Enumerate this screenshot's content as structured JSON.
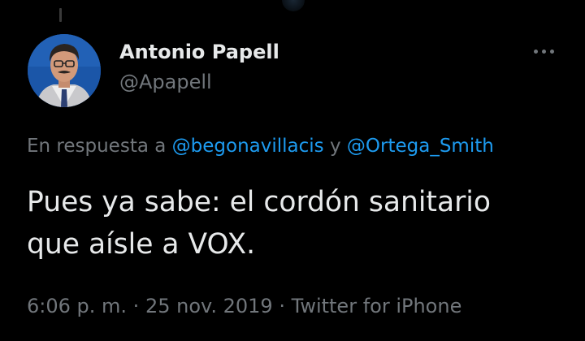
{
  "tweet": {
    "author": {
      "display_name": "Antonio Papell",
      "handle": "@Apapell",
      "avatar_icon": "profile-photo"
    },
    "more_icon": "more-horizontal-icon",
    "reply_to": {
      "prefix": "En respuesta a",
      "mention_1": "@begonavillacis",
      "connector": "y",
      "mention_2": "@Ortega_Smith"
    },
    "text_line_1": "Pues ya sabe: el cordón sanitario",
    "text_line_2": "que aísle a VOX.",
    "time": "6:06 p. m.",
    "date": "25 nov. 2019",
    "source": "Twitter for iPhone",
    "separator": "·"
  },
  "colors": {
    "background": "#000000",
    "primary_text": "#e7e9ea",
    "secondary_text": "#71767b",
    "link": "#1d9bf0"
  }
}
